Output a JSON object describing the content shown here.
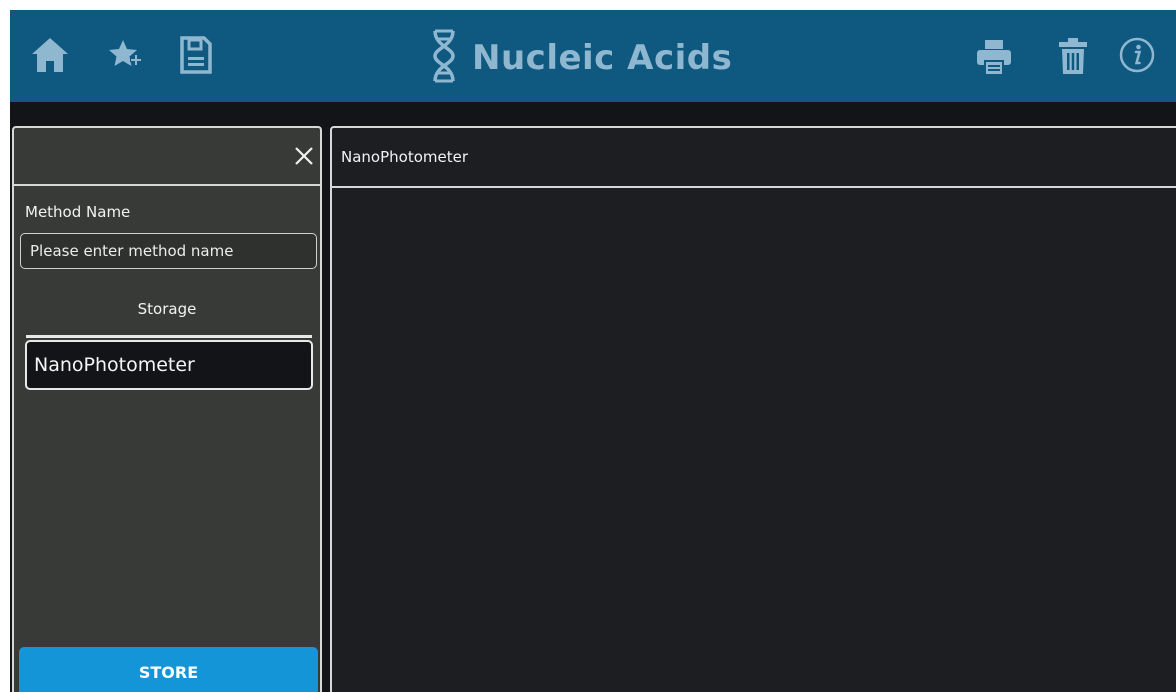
{
  "header": {
    "title": "Nucleic Acids",
    "icons": [
      "home-icon",
      "star-add-icon",
      "save-icon",
      "dna-icon",
      "print-icon",
      "trash-icon",
      "info-icon"
    ],
    "colors": {
      "bar": "#0f5880",
      "icon": "#8fb7d0"
    }
  },
  "side_panel": {
    "method_name_label": "Method Name",
    "method_name_value": "",
    "method_name_placeholder": "Please enter method name",
    "storage_label": "Storage",
    "storage_items": [
      "NanoPhotometer"
    ],
    "store_button": "STORE",
    "colors": {
      "panel": "#383a38",
      "store_button": "#1495d8"
    }
  },
  "main_panel": {
    "title": "NanoPhotometer"
  }
}
